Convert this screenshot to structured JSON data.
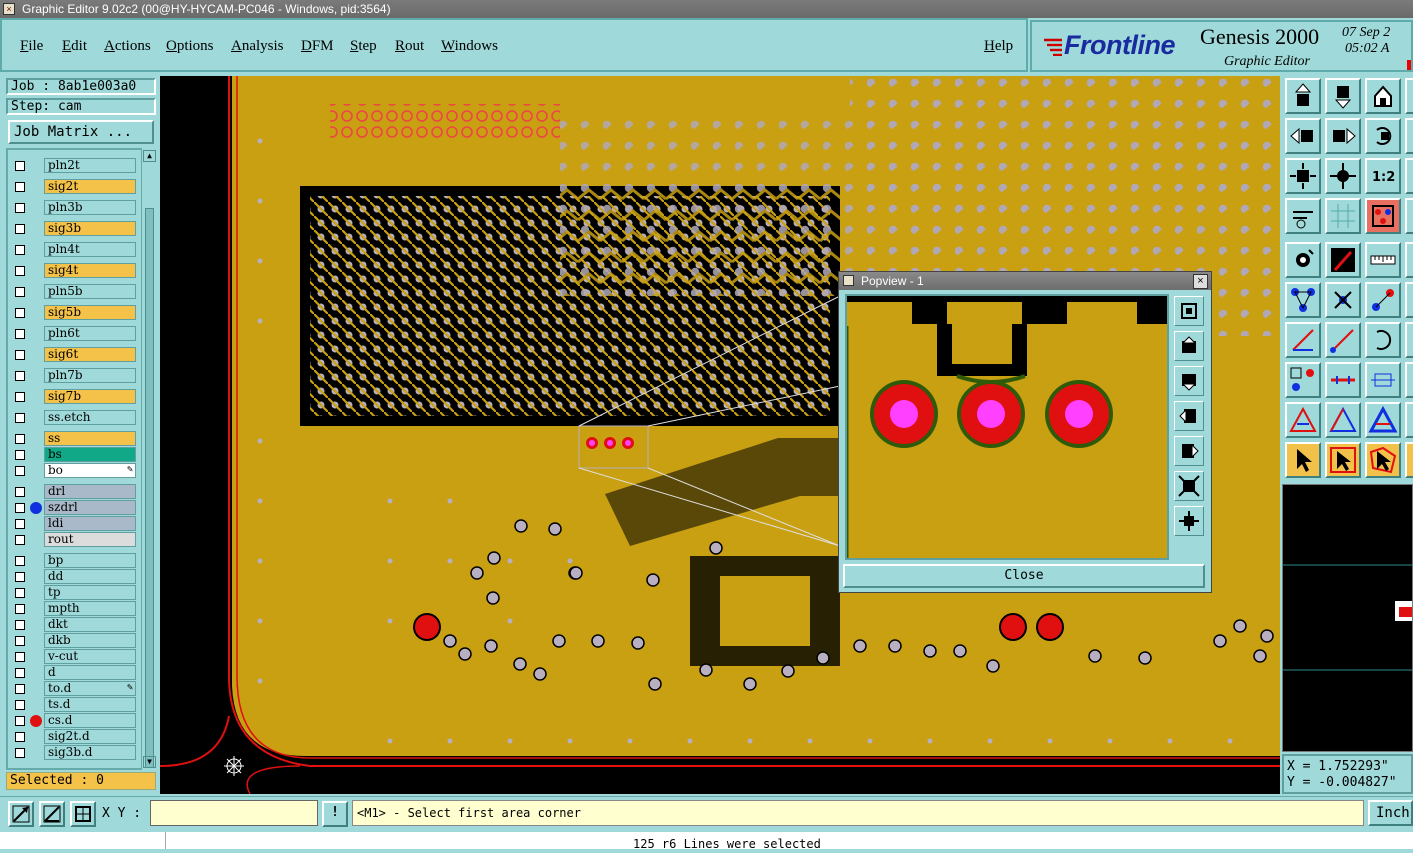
{
  "window": {
    "title": "Graphic Editor 9.02c2 (00@HY-HYCAM-PC046 - Windows, pid:3564)"
  },
  "menu": {
    "items": [
      "File",
      "Edit",
      "Actions",
      "Options",
      "Analysis",
      "DFM",
      "Step",
      "Rout",
      "Windows"
    ],
    "help": "Help"
  },
  "brand": {
    "logo_prefix": "F",
    "logo_rest": "rontline",
    "product": "Genesis 2000",
    "subtitle": "Graphic Editor",
    "date": "07 Sep 2",
    "time": "05:02 A"
  },
  "job": {
    "job_label": "Job : 8ab1e003a0",
    "step_label": "Step: cam",
    "matrix_button": "Job Matrix ..."
  },
  "layers": [
    {
      "name": "pln2t",
      "color": "#9fd9d9"
    },
    {
      "name": "sig2t",
      "color": "#f4c248"
    },
    {
      "name": "pln3b",
      "color": "#9fd9d9"
    },
    {
      "name": "sig3b",
      "color": "#f4c248"
    },
    {
      "name": "pln4t",
      "color": "#9fd9d9"
    },
    {
      "name": "sig4t",
      "color": "#f4c248"
    },
    {
      "name": "pln5b",
      "color": "#9fd9d9"
    },
    {
      "name": "sig5b",
      "color": "#f4c248"
    },
    {
      "name": "pln6t",
      "color": "#9fd9d9"
    },
    {
      "name": "sig6t",
      "color": "#f4c248"
    },
    {
      "name": "pln7b",
      "color": "#9fd9d9"
    },
    {
      "name": "sig7b",
      "color": "#f4c248"
    },
    {
      "name": "ss.etch",
      "color": "#9fd9d9"
    },
    {
      "name": "ss",
      "color": "#f4c248"
    },
    {
      "name": "bs",
      "color": "#11a888"
    },
    {
      "name": "bo",
      "color": "#ffffff",
      "edit": true
    },
    {
      "name": "drl",
      "color": "#a9b9c9"
    },
    {
      "name": "szdrl",
      "color": "#a9b9c9",
      "dot": "#1030e0"
    },
    {
      "name": "ldi",
      "color": "#a9b9c9"
    },
    {
      "name": "rout",
      "color": "#dcdcdc"
    },
    {
      "name": "bp",
      "color": "#9fd9d9"
    },
    {
      "name": "dd",
      "color": "#9fd9d9"
    },
    {
      "name": "tp",
      "color": "#9fd9d9"
    },
    {
      "name": "mpth",
      "color": "#9fd9d9"
    },
    {
      "name": "dkt",
      "color": "#9fd9d9"
    },
    {
      "name": "dkb",
      "color": "#9fd9d9"
    },
    {
      "name": "v-cut",
      "color": "#9fd9d9"
    },
    {
      "name": "d",
      "color": "#9fd9d9"
    },
    {
      "name": "to.d",
      "color": "#9fd9d9",
      "edit": true
    },
    {
      "name": "ts.d",
      "color": "#9fd9d9"
    },
    {
      "name": "cs.d",
      "color": "#9fd9d9",
      "dot": "#e01010"
    },
    {
      "name": "sig2t.d",
      "color": "#9fd9d9"
    },
    {
      "name": "sig3b.d",
      "color": "#9fd9d9"
    }
  ],
  "selected": {
    "label": "Selected : 0"
  },
  "popview": {
    "title": "Popview - 1",
    "close_label": "Close",
    "close_x": "×"
  },
  "coords": {
    "x": "X = 1.752293\"",
    "y": "Y = -0.004827\""
  },
  "bottom": {
    "xy_label": "X Y :",
    "xy_value": "",
    "mouse_button": "!",
    "prompt": "<M1> - Select first area corner",
    "units": "Inch"
  },
  "status": {
    "message": "125 r6 Lines were selected"
  },
  "colors": {
    "panel": "#9fd9d9",
    "copper": "#c8a012",
    "pad_red": "#e01010",
    "drill": "#ff40ff",
    "selected_bg": "#f4c248"
  }
}
